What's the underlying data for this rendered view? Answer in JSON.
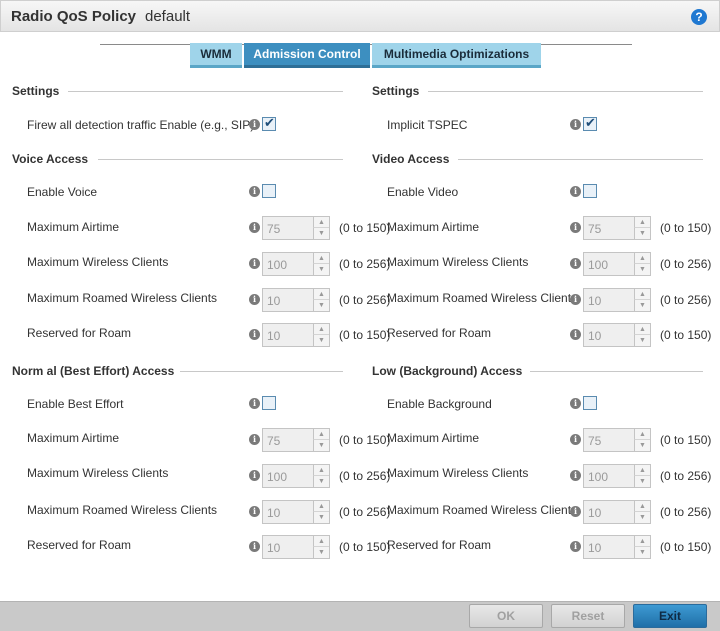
{
  "header": {
    "title": "Radio QoS Policy",
    "subtitle": "default",
    "help_icon": "?"
  },
  "tabs": [
    {
      "label": "WMM",
      "active": false
    },
    {
      "label": "Admission Control",
      "active": true
    },
    {
      "label": "Multimedia Optimizations",
      "active": false
    }
  ],
  "left_settings": {
    "title": "Settings",
    "firewall_label": "Firew all detection traffic Enable (e.g., SIP)",
    "firewall_checked": true
  },
  "right_settings": {
    "title": "Settings",
    "implicit_label": "Implicit TSPEC",
    "implicit_checked": true
  },
  "voice": {
    "title": "Voice Access",
    "enable_label": "Enable Voice",
    "enabled": false,
    "rows": [
      {
        "label": "Maximum Airtime",
        "value": "75",
        "range": "(0 to 150)"
      },
      {
        "label": "Maximum Wireless Clients",
        "value": "100",
        "range": "(0 to 256)"
      },
      {
        "label": "Maximum Roamed Wireless Clients",
        "value": "10",
        "range": "(0 to 256)"
      },
      {
        "label": "Reserved for Roam",
        "value": "10",
        "range": "(0 to 150)"
      }
    ]
  },
  "video": {
    "title": "Video Access",
    "enable_label": "Enable Video",
    "enabled": false,
    "rows": [
      {
        "label": "Maximum Airtime",
        "value": "75",
        "range": "(0 to 150)"
      },
      {
        "label": "Maximum Wireless Clients",
        "value": "100",
        "range": "(0 to 256)"
      },
      {
        "label": "Maximum Roamed Wireless Clients",
        "value": "10",
        "range": "(0 to 256)"
      },
      {
        "label": "Reserved for Roam",
        "value": "10",
        "range": "(0 to 150)"
      }
    ]
  },
  "normal": {
    "title": "Norm al (Best Effort) Access",
    "enable_label": "Enable Best Effort",
    "enabled": false,
    "rows": [
      {
        "label": "Maximum Airtime",
        "value": "75",
        "range": "(0 to 150)"
      },
      {
        "label": "Maximum Wireless Clients",
        "value": "100",
        "range": "(0 to 256)"
      },
      {
        "label": "Maximum Roamed Wireless Clients",
        "value": "10",
        "range": "(0 to 256)"
      },
      {
        "label": "Reserved for Roam",
        "value": "10",
        "range": "(0 to 150)"
      }
    ]
  },
  "low": {
    "title": "Low (Background) Access",
    "enable_label": "Enable Background",
    "enabled": false,
    "rows": [
      {
        "label": "Maximum Airtime",
        "value": "75",
        "range": "(0 to 150)"
      },
      {
        "label": "Maximum Wireless Clients",
        "value": "100",
        "range": "(0 to 256)"
      },
      {
        "label": "Maximum Roamed Wireless Clients",
        "value": "10",
        "range": "(0 to 256)"
      },
      {
        "label": "Reserved for Roam",
        "value": "10",
        "range": "(0 to 150)"
      }
    ]
  },
  "info_glyph": "i",
  "spinner_up": "▲",
  "spinner_down": "▼",
  "footer": {
    "ok_label": "OK",
    "reset_label": "Reset",
    "exit_label": "Exit"
  }
}
